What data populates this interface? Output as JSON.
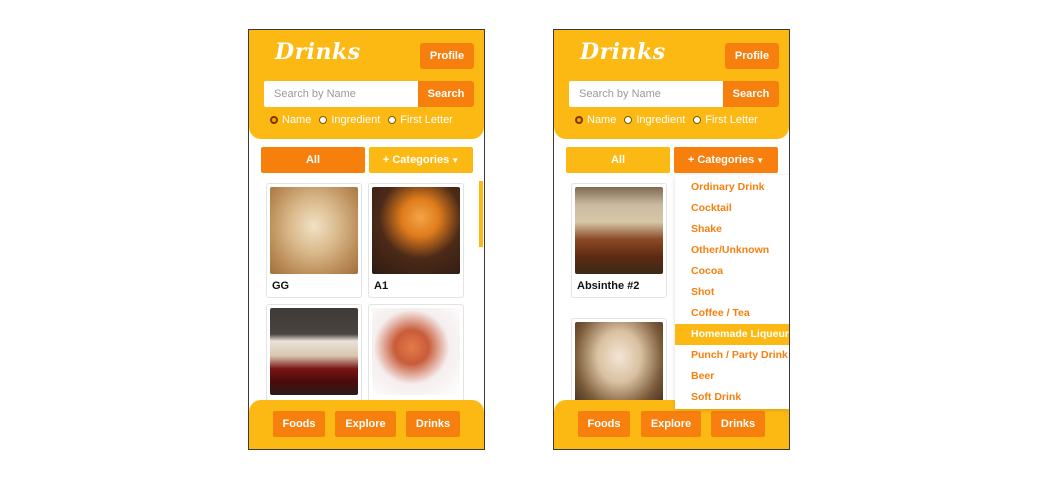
{
  "screens": [
    {
      "logo": "Drinks",
      "profile_label": "Profile",
      "search": {
        "placeholder": "Search by Name",
        "button_label": "Search"
      },
      "radios": [
        {
          "label": "Name",
          "checked": true
        },
        {
          "label": "Ingredient",
          "checked": false
        },
        {
          "label": "First Letter",
          "checked": false
        }
      ],
      "filters": {
        "all_label": "All",
        "categories_label": "+ Categories"
      },
      "cards": [
        {
          "name": "GG",
          "image": "whiskey-glass-photo"
        },
        {
          "name": "A1",
          "image": "orange-cocktail-photo"
        },
        {
          "name": "",
          "image": "layered-shot-photo"
        },
        {
          "name": "",
          "image": "wine-glass-photo"
        }
      ],
      "footer": [
        "Foods",
        "Explore",
        "Drinks"
      ]
    },
    {
      "logo": "Drinks",
      "profile_label": "Profile",
      "search": {
        "placeholder": "Search by Name",
        "button_label": "Search"
      },
      "radios": [
        {
          "label": "Name",
          "checked": true
        },
        {
          "label": "Ingredient",
          "checked": false
        },
        {
          "label": "First Letter",
          "checked": false
        }
      ],
      "filters": {
        "all_label": "All",
        "categories_label": "+ Categories"
      },
      "cards": [
        {
          "name": "Absinthe #2",
          "image": "absinthe-jar-photo"
        },
        {
          "name": "",
          "image": "liqueur-glass-photo"
        }
      ],
      "dropdown": {
        "items": [
          "Ordinary Drink",
          "Cocktail",
          "Shake",
          "Other/Unknown",
          "Cocoa",
          "Shot",
          "Coffee / Tea",
          "Homemade Liqueur",
          "Punch / Party Drink",
          "Beer",
          "Soft Drink"
        ],
        "active_item": "Homemade Liqueur"
      },
      "footer": [
        "Foods",
        "Explore",
        "Drinks"
      ]
    }
  ],
  "colors": {
    "brand_yellow": "#fdb913",
    "accent_orange": "#f77f0e"
  }
}
